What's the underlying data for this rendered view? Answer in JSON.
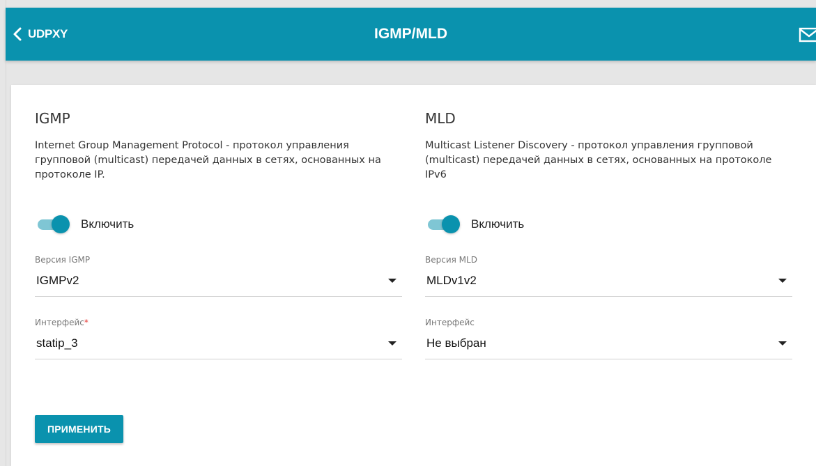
{
  "header": {
    "back_label": "UDPXY",
    "title": "IGMP/MLD",
    "back_icon": "chevron-left-icon",
    "mail_icon": "envelope-icon"
  },
  "igmp": {
    "title": "IGMP",
    "description_lines": [
      "Internet Group Management Protocol - протокол управления",
      "групповой (multicast) передачей данных в сетях, основанных на",
      "протоколе IP."
    ],
    "enable_label": "Включить",
    "enabled": true,
    "version_label": "Версия IGMP",
    "version_value": "IGMPv2",
    "interface_label": "Интерфейс",
    "interface_required_mark": "*",
    "interface_value": "statip_3"
  },
  "mld": {
    "title": "MLD",
    "description_lines": [
      "Multicast Listener Discovery - протокол управления групповой",
      "(multicast) передачей данных в сетях, основанных на протоколе",
      "IPv6"
    ],
    "enable_label": "Включить",
    "enabled": true,
    "version_label": "Версия MLD",
    "version_value": "MLDv1v2",
    "interface_label": "Интерфейс",
    "interface_value": "Не выбран"
  },
  "apply_label": "ПРИМЕНИТЬ",
  "colors": {
    "accent": "#0a92ae",
    "accent_light": "#7fc6d4",
    "required": "#e53935"
  }
}
